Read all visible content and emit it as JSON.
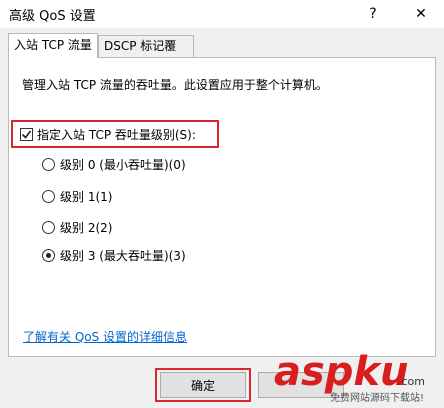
{
  "window": {
    "title": "高级 QoS 设置",
    "help_symbol": "?",
    "close_symbol": "✕"
  },
  "tabs": [
    {
      "label": "入站 TCP 流量",
      "active": true
    },
    {
      "label": "DSCP 标记覆盖",
      "active": false
    }
  ],
  "panel": {
    "description": "管理入站 TCP 流量的吞吐量。此设置应用于整个计算机。",
    "checkbox": {
      "label": "指定入站 TCP 吞吐量级别(S):",
      "checked": true
    },
    "radios": [
      {
        "label": "级别 0 (最小吞吐量)(0)",
        "checked": false
      },
      {
        "label": "级别 1(1)",
        "checked": false
      },
      {
        "label": "级别 2(2)",
        "checked": false
      },
      {
        "label": "级别 3 (最大吞吐量)(3)",
        "checked": true
      }
    ],
    "link": "了解有关 QoS 设置的详细信息"
  },
  "buttons": {
    "ok": "确定"
  },
  "watermark": {
    "brand": "aspku",
    "suffix": ".com",
    "tagline": "免费网站源码下载站!"
  },
  "colors": {
    "highlight_red": "#d9272e",
    "link_blue": "#0066cc",
    "watermark_red": "#d81e1e"
  }
}
